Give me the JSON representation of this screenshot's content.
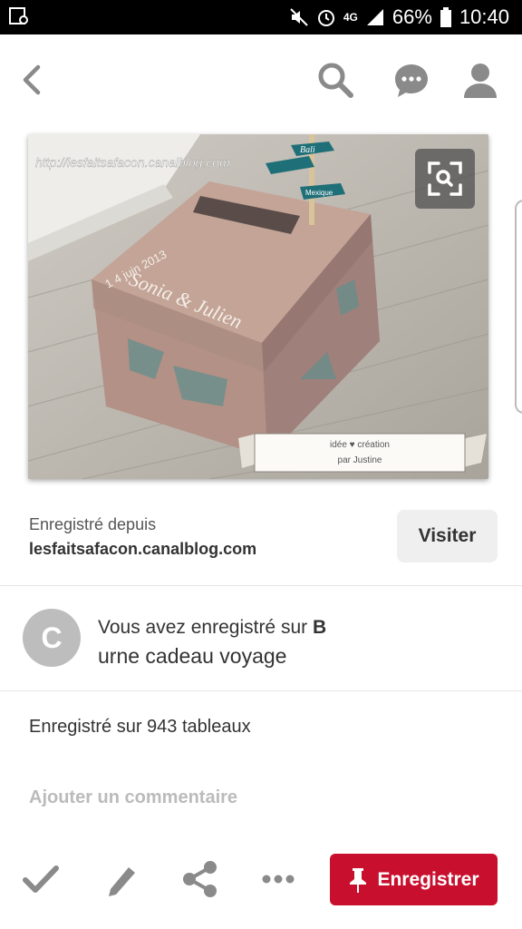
{
  "status_bar": {
    "battery": "66%",
    "time": "10:40",
    "network": "4G"
  },
  "nav": {
    "icons": [
      "back-icon",
      "search-icon",
      "chat-icon",
      "profile-icon"
    ]
  },
  "pin": {
    "watermark": "http://lesfaitsafacon.canalblog.com",
    "date_text": "1 4 juin 2013",
    "names_text": "Sonia & Julien",
    "sign_top": "Bali",
    "sign_bottom": "Mexique",
    "banner_line1": "idée ♥ création",
    "banner_line2": "par Justine"
  },
  "source": {
    "label": "Enregistré depuis",
    "site": "lesfaitsafacon.canalblog.com",
    "visit_label": "Visiter"
  },
  "user": {
    "avatar_letter": "C",
    "saved_prefix": "Vous avez enregistré sur ",
    "board_initial": "B",
    "board_name": "urne cadeau voyage"
  },
  "stats": {
    "saved_count_text": "Enregistré sur 943 tableaux"
  },
  "comment": {
    "placeholder": "Ajouter un commentaire"
  },
  "actions": {
    "save_label": "Enregistrer"
  },
  "colors": {
    "accent": "#c8102e",
    "box": "#b99a8e",
    "teal": "#1f6f78"
  }
}
